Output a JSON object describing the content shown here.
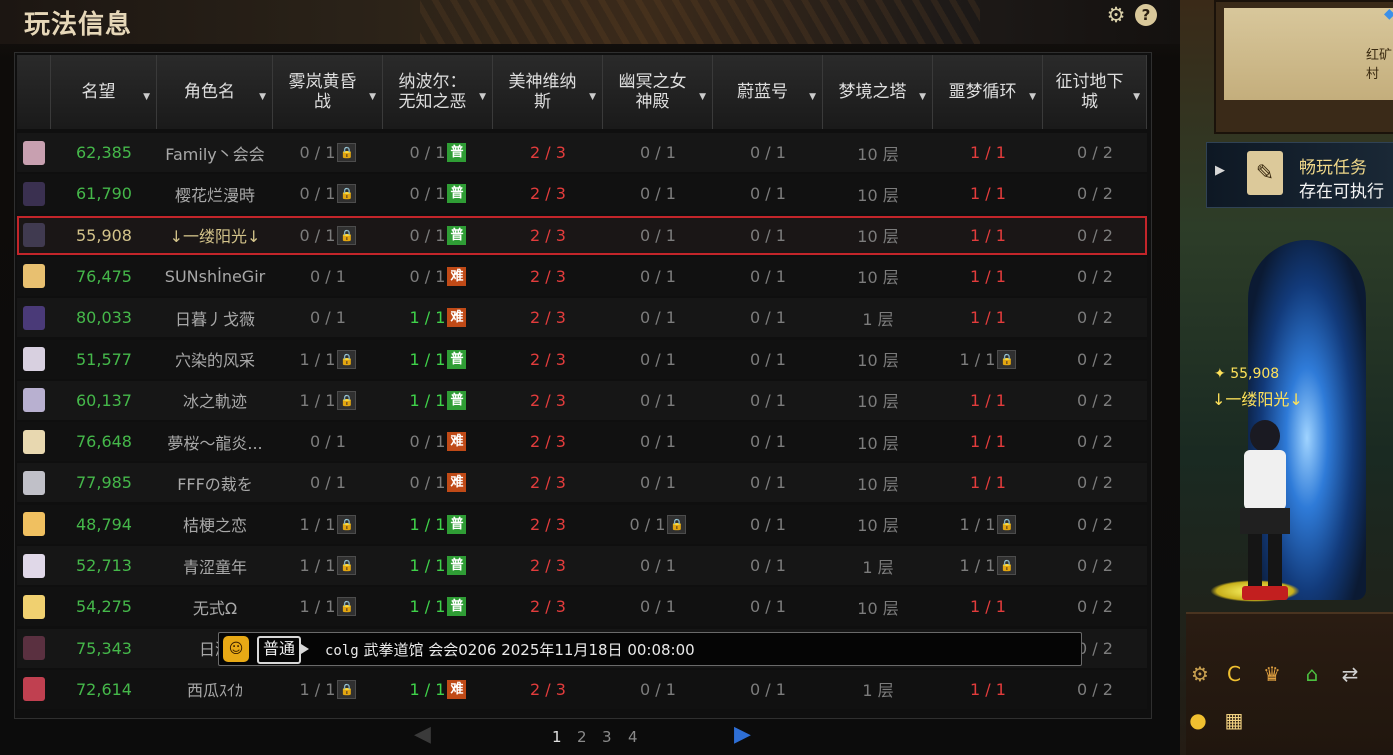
{
  "window": {
    "title": "玩法信息",
    "settings_icon": "gear-icon",
    "help_icon": "question-icon"
  },
  "columns": [
    "名望",
    "角色名",
    "雾岚黄昏战",
    "纳波尔：无知之恶",
    "美神维纳斯",
    "幽冥之女神殿",
    "蔚蓝号",
    "梦境之塔",
    "噩梦循环",
    "征讨地下城"
  ],
  "rows": [
    {
      "fame": "62,385",
      "name": "Family丶会会",
      "c1": "0 / 1",
      "c1_tag": "lock",
      "c2": "0 / 1",
      "c2_tag": "普",
      "c2_color": "gray",
      "c3": "2 / 3",
      "c4": "0 / 1",
      "c4_tag": "",
      "c5": "0 / 1",
      "c6": "10 层",
      "c7": "1 / 1",
      "c7_tag": "",
      "c7_color": "red",
      "c8": "0 / 2",
      "avatar": "#c8a0b0"
    },
    {
      "fame": "61,790",
      "name": "樱花烂漫時",
      "c1": "0 / 1",
      "c1_tag": "lock",
      "c2": "0 / 1",
      "c2_tag": "普",
      "c2_color": "gray",
      "c3": "2 / 3",
      "c4": "0 / 1",
      "c4_tag": "",
      "c5": "0 / 1",
      "c6": "10 层",
      "c7": "1 / 1",
      "c7_tag": "",
      "c7_color": "red",
      "c8": "0 / 2",
      "avatar": "#3a3050"
    },
    {
      "fame": "55,908",
      "name": "↓一缕阳光↓",
      "c1": "0 / 1",
      "c1_tag": "lock",
      "c2": "0 / 1",
      "c2_tag": "普",
      "c2_color": "gray",
      "c3": "2 / 3",
      "c4": "0 / 1",
      "c4_tag": "",
      "c5": "0 / 1",
      "c6": "10 层",
      "c7": "1 / 1",
      "c7_tag": "",
      "c7_color": "red",
      "c8": "0 / 2",
      "avatar": "#403a50",
      "selected": true
    },
    {
      "fame": "76,475",
      "name": "SUNshİneGir",
      "c1": "0 / 1",
      "c1_tag": "",
      "c2": "0 / 1",
      "c2_tag": "难",
      "c2_color": "gray",
      "c3": "2 / 3",
      "c4": "0 / 1",
      "c4_tag": "",
      "c5": "0 / 1",
      "c6": "10 层",
      "c7": "1 / 1",
      "c7_tag": "",
      "c7_color": "red",
      "c8": "0 / 2",
      "avatar": "#e8c070"
    },
    {
      "fame": "80,033",
      "name": "日暮丿戈薇",
      "c1": "0 / 1",
      "c1_tag": "",
      "c2": "1 / 1",
      "c2_tag": "难",
      "c2_color": "green",
      "c3": "2 / 3",
      "c4": "0 / 1",
      "c4_tag": "",
      "c5": "0 / 1",
      "c6": "1 层",
      "c7": "1 / 1",
      "c7_tag": "",
      "c7_color": "red",
      "c8": "0 / 2",
      "avatar": "#4a3a78"
    },
    {
      "fame": "51,577",
      "name": "穴染的风采",
      "c1": "1 / 1",
      "c1_tag": "lock",
      "c2": "1 / 1",
      "c2_tag": "普",
      "c2_color": "green",
      "c3": "2 / 3",
      "c4": "0 / 1",
      "c4_tag": "",
      "c5": "0 / 1",
      "c6": "10 层",
      "c7": "1 / 1",
      "c7_tag": "lock",
      "c7_color": "gray",
      "c8": "0 / 2",
      "avatar": "#d8d0e0"
    },
    {
      "fame": "60,137",
      "name": "冰之軌迹",
      "c1": "1 / 1",
      "c1_tag": "lock",
      "c2": "1 / 1",
      "c2_tag": "普",
      "c2_color": "green",
      "c3": "2 / 3",
      "c4": "0 / 1",
      "c4_tag": "",
      "c5": "0 / 1",
      "c6": "10 层",
      "c7": "1 / 1",
      "c7_tag": "",
      "c7_color": "red",
      "c8": "0 / 2",
      "avatar": "#b8b0d0"
    },
    {
      "fame": "76,648",
      "name": "夢桜～龍炎...",
      "c1": "0 / 1",
      "c1_tag": "",
      "c2": "0 / 1",
      "c2_tag": "难",
      "c2_color": "gray",
      "c3": "2 / 3",
      "c4": "0 / 1",
      "c4_tag": "",
      "c5": "0 / 1",
      "c6": "10 层",
      "c7": "1 / 1",
      "c7_tag": "",
      "c7_color": "red",
      "c8": "0 / 2",
      "avatar": "#e8d8b0"
    },
    {
      "fame": "77,985",
      "name": "FFFの裁を",
      "c1": "0 / 1",
      "c1_tag": "",
      "c2": "0 / 1",
      "c2_tag": "难",
      "c2_color": "gray",
      "c3": "2 / 3",
      "c4": "0 / 1",
      "c4_tag": "",
      "c5": "0 / 1",
      "c6": "10 层",
      "c7": "1 / 1",
      "c7_tag": "",
      "c7_color": "red",
      "c8": "0 / 2",
      "avatar": "#c0c0c8"
    },
    {
      "fame": "48,794",
      "name": "桔梗之恋",
      "c1": "1 / 1",
      "c1_tag": "lock",
      "c2": "1 / 1",
      "c2_tag": "普",
      "c2_color": "green",
      "c3": "2 / 3",
      "c4": "0 / 1",
      "c4_tag": "lock",
      "c5": "0 / 1",
      "c6": "10 层",
      "c7": "1 / 1",
      "c7_tag": "lock",
      "c7_color": "gray",
      "c8": "0 / 2",
      "avatar": "#f0c060"
    },
    {
      "fame": "52,713",
      "name": "青涩童年",
      "c1": "1 / 1",
      "c1_tag": "lock",
      "c2": "1 / 1",
      "c2_tag": "普",
      "c2_color": "green",
      "c3": "2 / 3",
      "c4": "0 / 1",
      "c4_tag": "",
      "c5": "0 / 1",
      "c6": "1 层",
      "c7": "1 / 1",
      "c7_tag": "lock",
      "c7_color": "gray",
      "c8": "0 / 2",
      "avatar": "#e0d8e8"
    },
    {
      "fame": "54,275",
      "name": "无式Ω",
      "c1": "1 / 1",
      "c1_tag": "lock",
      "c2": "1 / 1",
      "c2_tag": "普",
      "c2_color": "green",
      "c3": "2 / 3",
      "c4": "0 / 1",
      "c4_tag": "",
      "c5": "0 / 1",
      "c6": "10 层",
      "c7": "1 / 1",
      "c7_tag": "",
      "c7_color": "red",
      "c8": "0 / 2",
      "avatar": "#f0d070"
    },
    {
      "fame": "75,343",
      "name": "日淝",
      "c8": "0 / 2",
      "avatar": "#5a3040",
      "partial": true
    },
    {
      "fame": "72,614",
      "name": "西瓜ｽｲｶ",
      "c1": "1 / 1",
      "c1_tag": "lock",
      "c2": "1 / 1",
      "c2_tag": "难",
      "c2_color": "green",
      "c3": "2 / 3",
      "c4": "0 / 1",
      "c4_tag": "",
      "c5": "0 / 1",
      "c6": "1 层",
      "c7": "1 / 1",
      "c7_tag": "",
      "c7_color": "red",
      "c8": "0 / 2",
      "avatar": "#c04050"
    }
  ],
  "pager": {
    "pages": [
      "1",
      "2",
      "3",
      "4"
    ],
    "current": "1"
  },
  "chat": {
    "channel": "普通",
    "user": "colg",
    "message": "武拳道馆 会会0206 2025年11月18日 00:08:00"
  },
  "game": {
    "map_label": "红矿村",
    "quest_title": "畅玩任务",
    "quest_desc": "存在可执行",
    "player_fame": "55,908",
    "player_name": "↓一缕阳光↓"
  },
  "colors": {
    "green": "#3fd24a",
    "red": "#e23c3c",
    "fame": "#45b84a",
    "selected_border": "#c3252a"
  }
}
